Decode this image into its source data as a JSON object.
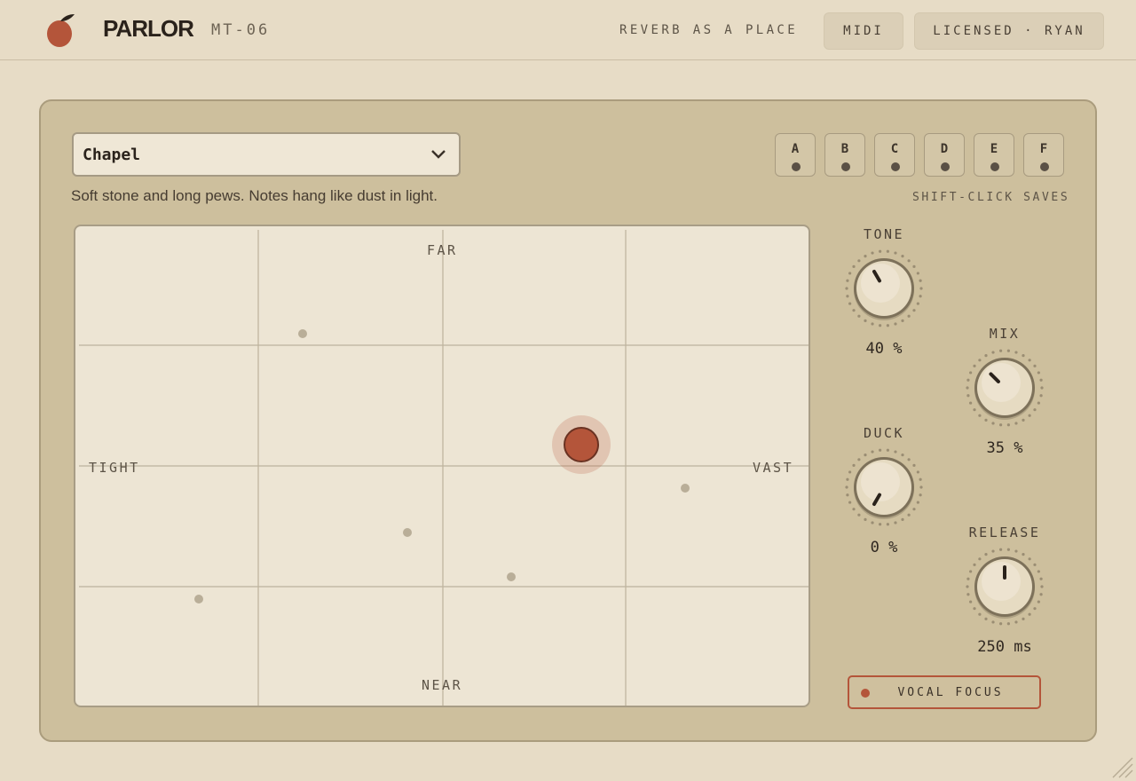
{
  "header": {
    "brand": "PARLOR",
    "model": "MT-06",
    "tagline": "REVERB AS A PLACE",
    "midi_label": "MIDI",
    "license_label": "LICENSED · RYAN"
  },
  "preset": {
    "name": "Chapel",
    "description": "Soft stone and long pews. Notes hang like dust in light."
  },
  "slots": {
    "items": [
      {
        "label": "A"
      },
      {
        "label": "B"
      },
      {
        "label": "C"
      },
      {
        "label": "D"
      },
      {
        "label": "E"
      },
      {
        "label": "F"
      }
    ],
    "note": "SHIFT-CLICK SAVES"
  },
  "pad": {
    "top_label": "FAR",
    "bottom_label": "NEAR",
    "left_label": "TIGHT",
    "right_label": "VAST"
  },
  "knobs": {
    "tone": {
      "label": "TONE",
      "value": "40 %",
      "level": 0.4
    },
    "mix": {
      "label": "MIX",
      "value": "35 %",
      "level": 0.35
    },
    "duck": {
      "label": "DUCK",
      "value": "0 %",
      "level": 0.0
    },
    "release": {
      "label": "RELEASE",
      "value": "250 ms",
      "level": 0.5
    }
  },
  "vocal_focus": {
    "label": "VOCAL FOCUS"
  },
  "colors": {
    "accent": "#b4553a",
    "panel": "#cdbf9d",
    "background": "#e7dcc6"
  }
}
